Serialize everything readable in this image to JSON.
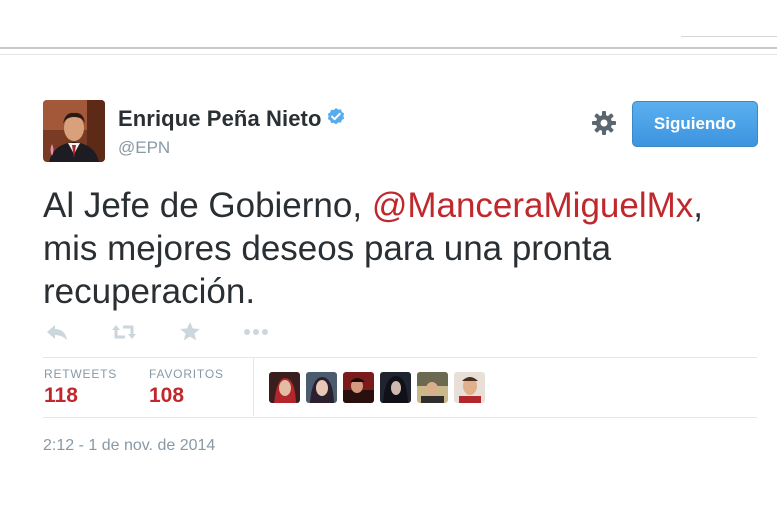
{
  "author": {
    "display_name": "Enrique Peña Nieto",
    "handle": "@EPN",
    "verified": true
  },
  "follow_button": {
    "label": "Siguiendo"
  },
  "tweet": {
    "text_before": "Al Jefe de Gobierno, ",
    "mention": "@ManceraMiguelMx",
    "text_after": ", mis mejores deseos para una pronta recuperación."
  },
  "actions": [
    "reply-icon",
    "retweet-icon",
    "favorite-icon",
    "more-icon"
  ],
  "stats": {
    "retweets_label": "RETWEETS",
    "retweets_count": "118",
    "favorites_label": "FAVORITOS",
    "favorites_count": "108"
  },
  "timestamp": "2:12 - 1 de nov. de 2014",
  "colors": {
    "mention": "#c0282d",
    "button": "#4aa1e8",
    "muted": "#8899a6"
  }
}
